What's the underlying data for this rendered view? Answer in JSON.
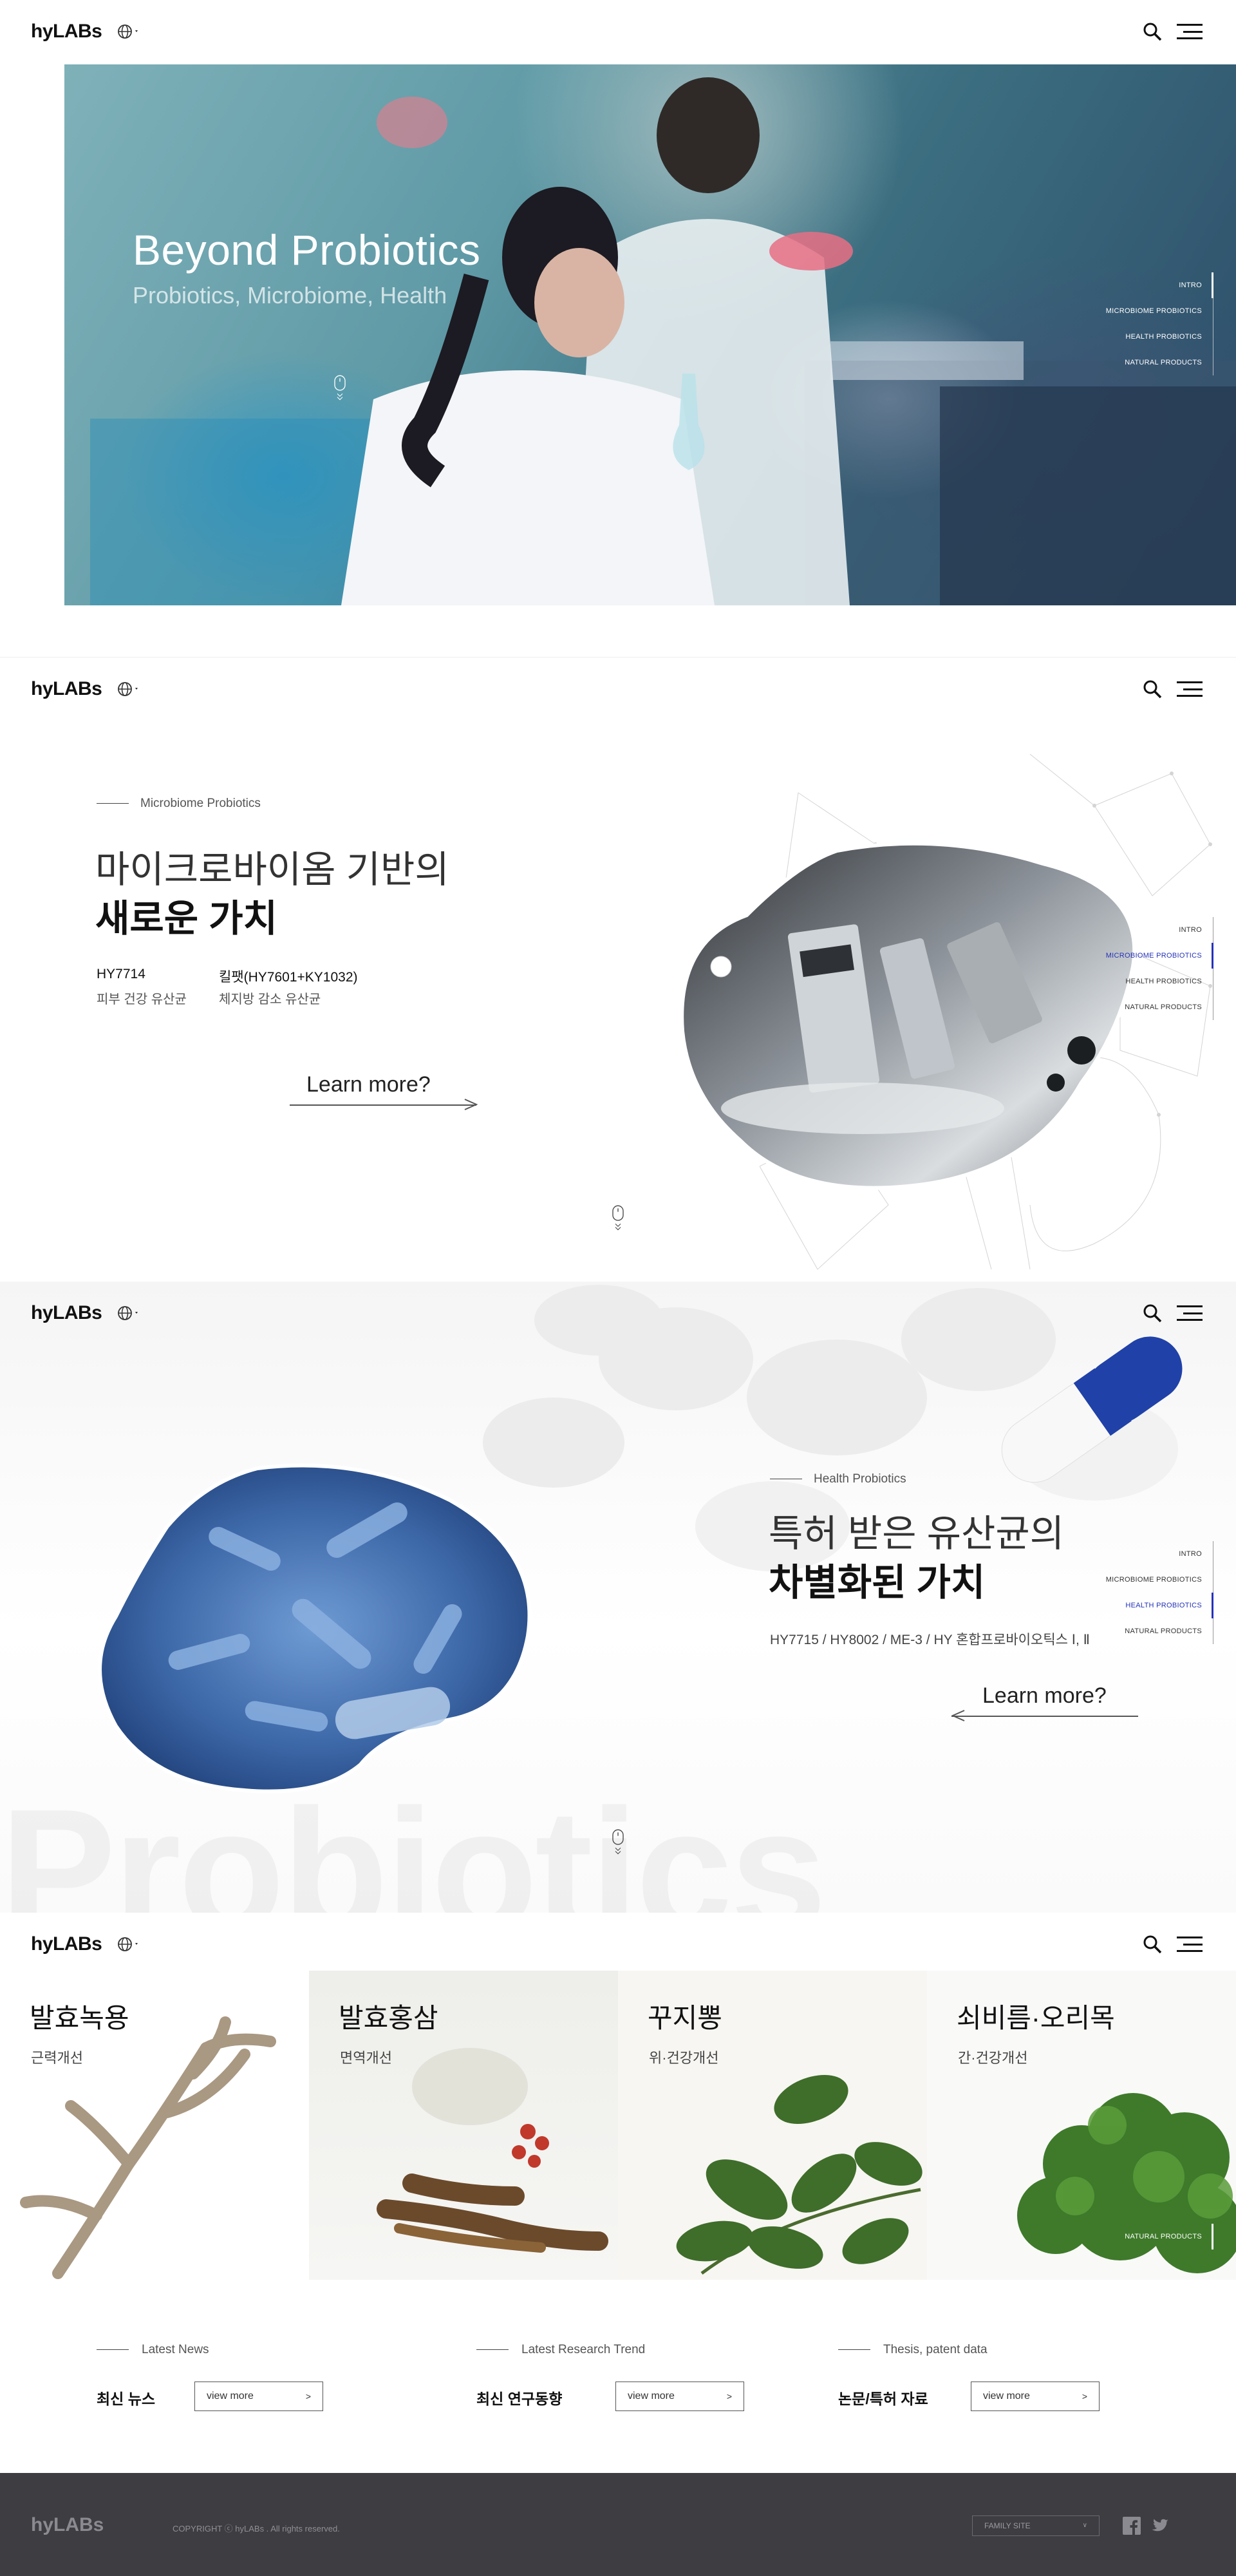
{
  "brand": {
    "logo": "hyLABs"
  },
  "sidenav": [
    "INTRO",
    "MICROBIOME PROBIOTICS",
    "HEALTH PROBIOTICS",
    "NATURAL PRODUCTS"
  ],
  "hero": {
    "title": "Beyond Probiotics",
    "subtitle": "Probiotics, Microbiome, Health"
  },
  "microbiome": {
    "eyebrow": "Microbiome Probiotics",
    "headline_light": "마이크로바이옴 기반의",
    "headline_bold": "새로운 가치",
    "products": [
      {
        "name": "HY7714",
        "desc": "피부 건강 유산균"
      },
      {
        "name": "킬팻(HY7601+KY1032)",
        "desc": "체지방 감소 유산균"
      }
    ],
    "cta": "Learn more?"
  },
  "health": {
    "eyebrow": "Health Probiotics",
    "headline_light": "특허 받은 유산균의",
    "headline_bold": "차별화된 가치",
    "ids": "HY7715 / HY8002 / ME-3 / HY 혼합프로바이오틱스 Ⅰ, Ⅱ",
    "cta": "Learn more?",
    "background_word": "Probiotics"
  },
  "natural": {
    "panels": [
      {
        "title": "발효녹용",
        "sub": "근력개선"
      },
      {
        "title": "발효홍삼",
        "sub": "면역개선"
      },
      {
        "title": "꾸지뽕",
        "sub": "위·건강개선"
      },
      {
        "title": "쇠비름·오리목",
        "sub": "간·건강개선"
      }
    ]
  },
  "news": [
    {
      "eyebrow": "Latest News",
      "title": "최신 뉴스",
      "button": "view more"
    },
    {
      "eyebrow": "Latest Research Trend",
      "title": "최신 연구동향",
      "button": "view more"
    },
    {
      "eyebrow": "Thesis, patent data",
      "title": "논문/특허 자료",
      "button": "view more"
    }
  ],
  "footer": {
    "logo": "hyLABs",
    "copyright": "COPYRIGHT ⓒ hyLABs . All rights reserved.",
    "family_site": "FAMILY SITE"
  },
  "colors": {
    "accent": "#2532b8",
    "footer_bg": "#3d3d42"
  }
}
